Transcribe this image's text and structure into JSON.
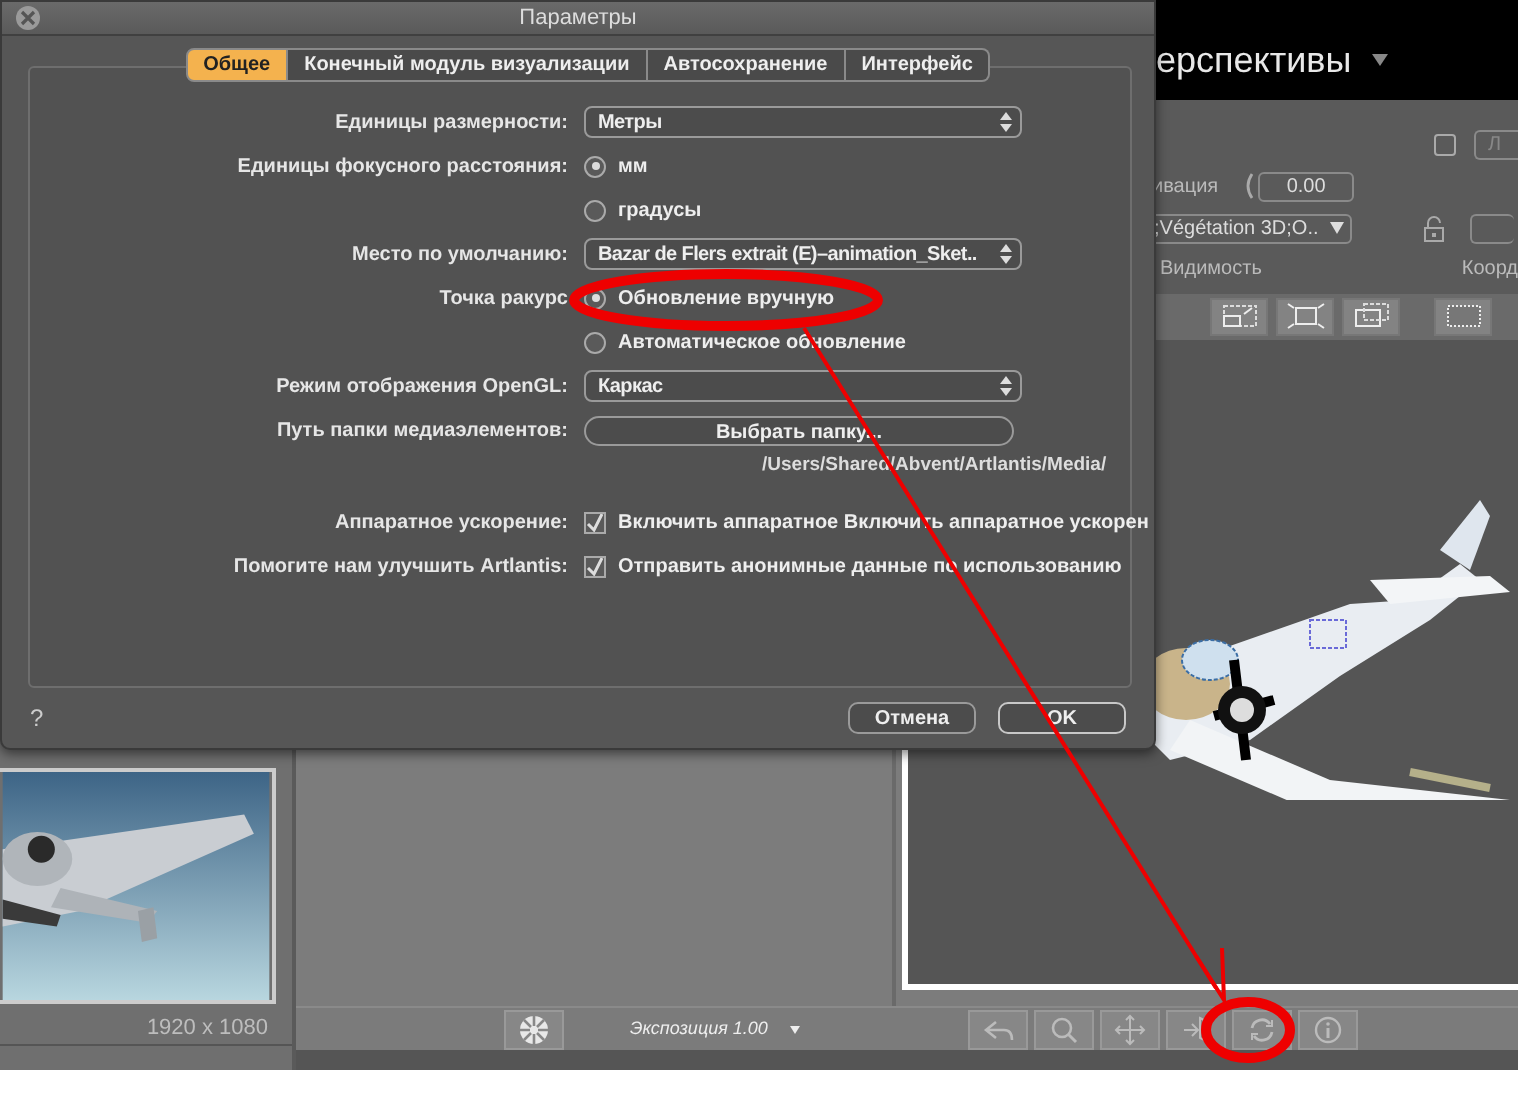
{
  "app": {
    "header": {
      "title": "ерспективы"
    },
    "panel": {
      "lock_checkbox": {
        "checked": false
      },
      "field_1": "Л",
      "label_1": "ивация",
      "value_field": "0.00",
      "layers_dropdown": ";Végétation 3D;O..",
      "column_labels": [
        "Видимость",
        "Коорд"
      ]
    },
    "thumbnail": {
      "kind": "picture",
      "size": "1920 x 1080"
    },
    "toolbar": {
      "exposure": "Экспозиция 1.00"
    }
  },
  "dialog": {
    "title": "Параметры",
    "tabs": [
      {
        "label": "Общее",
        "selected": true
      },
      {
        "label": "Конечный модуль визуализации",
        "selected": false
      },
      {
        "label": "Автосохранение",
        "selected": false
      },
      {
        "label": "Интерфейс",
        "selected": false
      }
    ],
    "settings": [
      {
        "kind": "select",
        "label": "Единицы размерности:",
        "value": "Метры"
      },
      {
        "kind": "radio",
        "label": "Единицы фокусного расстояния:",
        "options": [
          {
            "label": "мм",
            "selected": true
          },
          {
            "label": "градусы",
            "selected": false
          }
        ]
      },
      {
        "kind": "select",
        "label": "Место по умолчанию:",
        "value": "Bazar de Flers extrait (E)–animation_Sket.."
      },
      {
        "kind": "radio",
        "label": "Точка ракурс",
        "options": [
          {
            "label": "Обновление вручную",
            "selected": true
          },
          {
            "label": "Автоматическое обновление",
            "selected": false
          }
        ]
      },
      {
        "kind": "select",
        "label": "Режим отображения OpenGL:",
        "value": "Каркас"
      },
      {
        "kind": "button",
        "label": "Путь папки медиаэлементов:",
        "value": "Выбрать папку...",
        "note": "/Users/Shared/Abvent/Artlantis/Media/"
      },
      {
        "kind": "checkbox",
        "label": "Аппаратное ускорение:",
        "text": "Включить аппаратное Включить аппаратное ускорен",
        "checked": true
      },
      {
        "kind": "checkbox",
        "label": "Помогите нам улучшить Artlantis:",
        "text": "Отправить анонимные данные по использованию",
        "checked": true
      }
    ],
    "help": "?",
    "buttons": [
      {
        "label": "Отмена",
        "default": false
      },
      {
        "label": "OK",
        "default": true
      }
    ]
  }
}
